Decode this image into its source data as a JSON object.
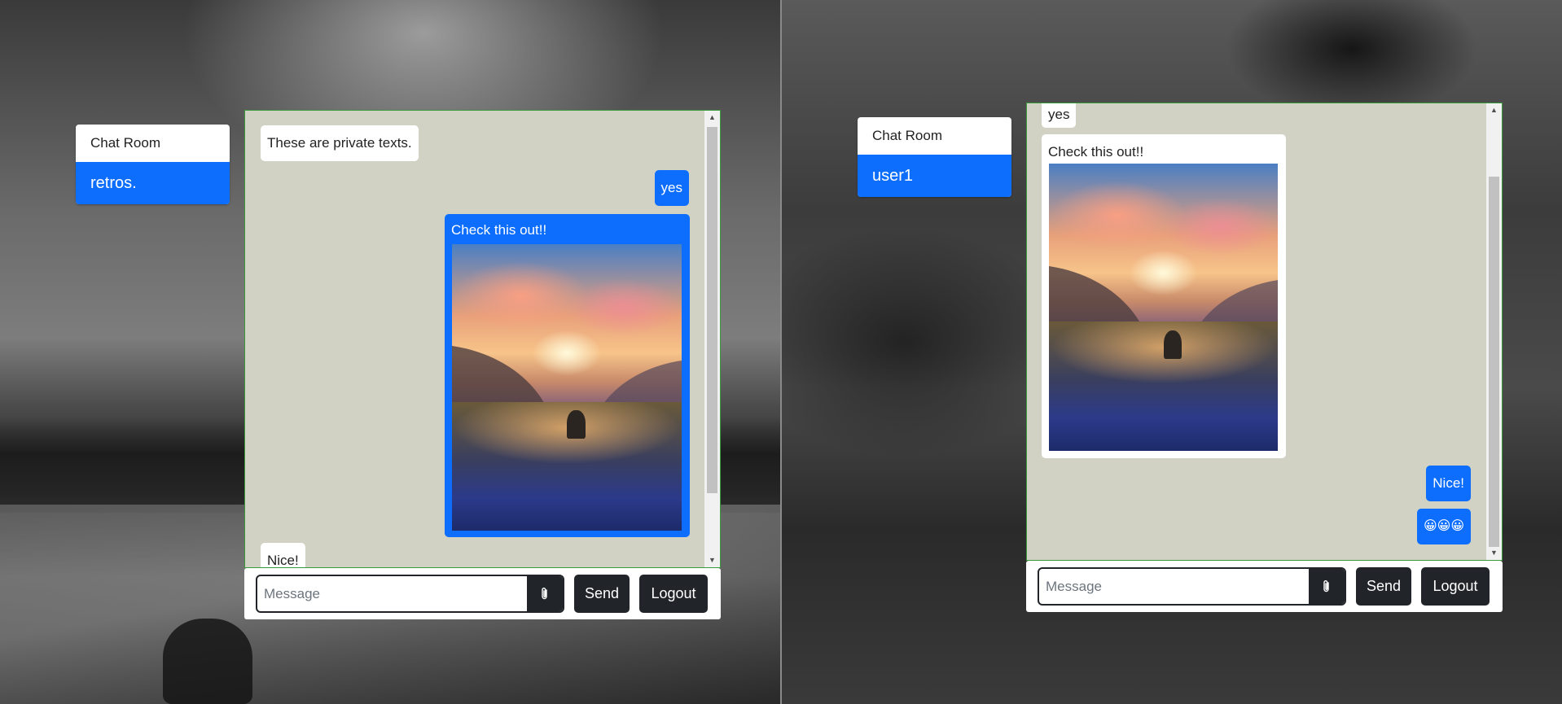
{
  "left": {
    "room": {
      "header": "Chat Room",
      "user": "retros."
    },
    "messages": [
      {
        "side": "in",
        "text": "These are private texts."
      },
      {
        "side": "out",
        "text": "yes"
      },
      {
        "side": "out",
        "text": "Check this out!!"
      },
      {
        "side": "in",
        "text": "Nice!"
      }
    ],
    "composer": {
      "placeholder": "Message",
      "send_label": "Send",
      "logout_label": "Logout"
    }
  },
  "right": {
    "room": {
      "header": "Chat Room",
      "user": "user1"
    },
    "messages": [
      {
        "side": "in",
        "text": "yes"
      },
      {
        "side": "in",
        "text": "Check this out!!"
      },
      {
        "side": "out",
        "text": "Nice!"
      },
      {
        "side": "out",
        "text": "😀😀😀"
      }
    ],
    "composer": {
      "placeholder": "Message",
      "send_label": "Send",
      "logout_label": "Logout"
    }
  },
  "colors": {
    "accent": "#0d6efd",
    "chat_bg": "#d1d2c4",
    "button_dark": "#212529",
    "chat_border": "#3a9a3a"
  },
  "icons": {
    "attach": "paperclip-icon",
    "scroll_up": "arrow-up-icon",
    "scroll_down": "arrow-down-icon"
  }
}
